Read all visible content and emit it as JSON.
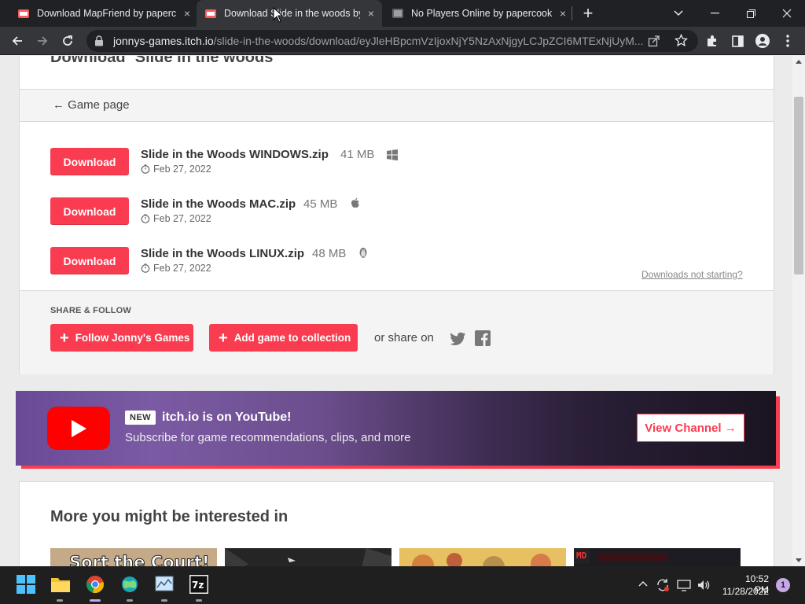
{
  "browser": {
    "tabs": [
      {
        "title": "Download MapFriend by paperco",
        "close": "×"
      },
      {
        "title": "Download Slide in the woods by",
        "close": "×"
      },
      {
        "title": "No Players Online by papercooki",
        "close": "×"
      }
    ],
    "new_tab": "+",
    "url_host": "jonnys-games.itch.io",
    "url_path": "/slide-in-the-woods/download/eyJleHBpcmVzIjoxNjY5NzAxNjgyLCJpZCI6MTExNjUyM..."
  },
  "page": {
    "title_prefix": "Download ",
    "title_open_quote": "“",
    "title_game": "Slide in the woods",
    "title_close_quote": "”",
    "game_page_link": "← Game page",
    "downloads": [
      {
        "button": "Download",
        "name": "Slide in the Woods WINDOWS.zip",
        "size": "41 MB",
        "os_icon": "windows-icon",
        "date": "Feb 27, 2022"
      },
      {
        "button": "Download",
        "name": "Slide in the Woods MAC.zip",
        "size": "45 MB",
        "os_icon": "apple-icon",
        "date": "Feb 27, 2022"
      },
      {
        "button": "Download",
        "name": "Slide in the Woods LINUX.zip",
        "size": "48 MB",
        "os_icon": "linux-icon",
        "date": "Feb 27, 2022"
      }
    ],
    "downloads_not_starting": "Downloads not starting?",
    "share": {
      "label": "SHARE & FOLLOW",
      "follow_button": "Follow Jonny's Games",
      "collection_button": "Add game to collection",
      "or_share_on": "or share on"
    },
    "youtube": {
      "badge": "NEW",
      "headline": "itch.io is on YouTube!",
      "subtitle": "Subscribe for game recommendations, clips, and more",
      "button": "View Channel →"
    },
    "more_title": "More you might be interested in",
    "thumb_1_text": "Sort the Court!",
    "thumb_4_text": "MD"
  },
  "taskbar": {
    "time": "10:52 PM",
    "date": "11/28/2022",
    "notifications": "1"
  },
  "colors": {
    "accent": "#fa3c50",
    "chrome_dark": "#202124",
    "chrome_toolbar": "#35363a",
    "youtube_red": "#ff0000"
  }
}
